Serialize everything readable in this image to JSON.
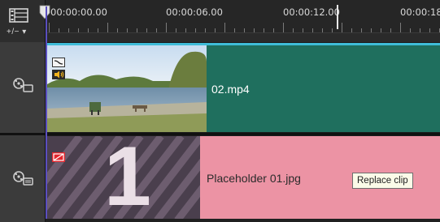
{
  "ruler": {
    "timecodes": [
      "00:00:00.00",
      "00:00:06.00",
      "00:00:12.00",
      "00:00:18"
    ]
  },
  "toolbar": {
    "zoom_label": "+/− ▾"
  },
  "tracks": {
    "video": {
      "clip_name": "02.mp4",
      "clip_color": "#1f6f5e",
      "selection_color": "#3fbcd8",
      "icons": [
        "transition-icon",
        "audio-icon"
      ]
    },
    "overlay": {
      "clip_name": "Placeholder 01.jpg",
      "clip_color": "#ec93a4",
      "placeholder_number": "1",
      "icons": [
        "placeholder-icon"
      ]
    }
  },
  "tooltip": {
    "text": "Replace clip"
  },
  "colors": {
    "playhead": "#5a4fbf",
    "background": "#1b1b1b"
  }
}
